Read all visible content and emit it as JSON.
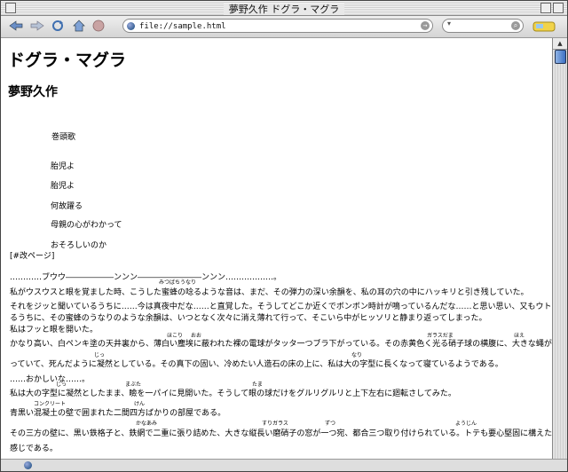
{
  "window": {
    "title": "夢野久作 ドグラ・マグラ"
  },
  "toolbar": {
    "url": "file://sample.html",
    "search_placeholder": ""
  },
  "doc": {
    "title": "ドグラ・マグラ",
    "author": "夢野久作",
    "epigraph_heading": "巻頭歌",
    "poem": [
      "胎児よ",
      "胎児よ",
      "何故躍る",
      "母親の心がわかって",
      "おそろしいのか"
    ],
    "page_marker": "[#改ページ]",
    "lines": [
      "…………ブウウ――――――ンンン――――――――ンンン………………。",
      "私がウスウスと眼を覚ました時、こうした蜜蜂の唸るような音は、まだ、その弾力の深い余韻を、私の耳の穴の中にハッキリと引き残していた。",
      "それをジッと聞いているうちに……今は真夜中だな……と直覚した。そうしてどこか近くでボンボン時計が鳴っているんだな……と思い思い、又もウトウトしてい",
      "るうちに、その蜜蜂のうなりのような余韻は、いつとなく次々に消え薄れて行って、そこいら中がヒッソリと静まり返ってしまった。",
      "私はフッと眼を開いた。",
      "かなり高い、白ペンキ塗の天井裏から、薄白い塵埃に蔽われた裸の電球がタッタ一つブラ下がっている。その赤黄色く光る硝子球の横腹に、大きな蠅が一匹とま",
      "っていて、死んだように凝然としている。その真下の固い、冷めたい人造石の床の上に、私は大の字型に長くなって寝ているようである。",
      "……おかしいな……。",
      "私は大の字型に凝然としたまま、瞼を一パイに見開いた。そうして眼の球だけをグルリグルリと上下左右に廻転さしてみた。",
      "青黒い混凝土の壁で囲まれた二間四方ばかりの部屋である。",
      "その三方の壁に、黒い鉄格子と、鉄網で二重に張り詰めた、大きな縦長い磨硝子の窓が一つ宛、都合三つ取り付けられている。トテも要心堅固に構えた部屋の",
      "感じである。"
    ],
    "ruby": [
      "みつばちうなり",
      "ほこり",
      "おお",
      "ガラスだま",
      "ほえ",
      "じっ",
      "なり",
      "まぶた",
      "たま",
      "コンクリート",
      "けん",
      "かなあみ",
      "すりガラス",
      "ずつ",
      "ようじん"
    ]
  }
}
